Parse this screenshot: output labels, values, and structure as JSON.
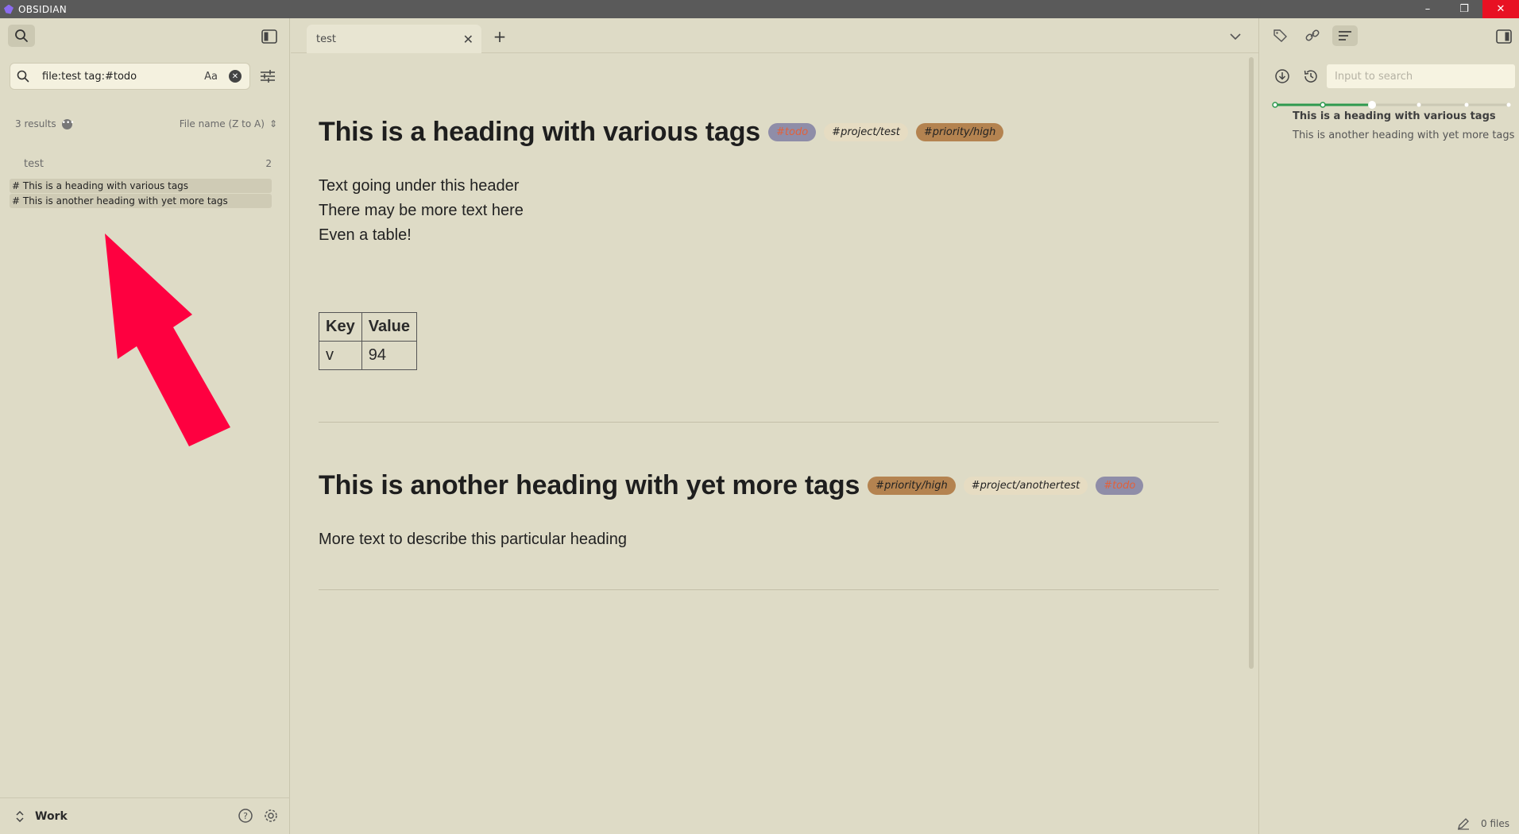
{
  "app": {
    "title": "OBSIDIAN"
  },
  "window": {
    "minimize": "–",
    "maximize": "❐",
    "close": "✕"
  },
  "left": {
    "search_query": "file:test tag:#todo",
    "match_case": "Aa",
    "results_count": "3 results",
    "sort_label": "File name (Z to A)",
    "result_file": "test",
    "result_file_count": "2",
    "matches": [
      "# This is a heading with various tags",
      "# This is another heading with yet more tags"
    ],
    "vault_name": "Work"
  },
  "tabs": [
    {
      "label": "test"
    }
  ],
  "doc": {
    "heading1": "This is a heading with various tags",
    "heading1_tags": [
      "#todo",
      "#project/test",
      "#priority/high"
    ],
    "para1_line1": "Text going under this header",
    "para1_line2": "There may be more text here",
    "para2": "Even a table!",
    "table": {
      "headers": [
        "Key",
        "Value"
      ],
      "rows": [
        [
          "v",
          "94"
        ]
      ]
    },
    "heading2": "This is another heading with yet more tags",
    "heading2_tags": [
      "#priority/high",
      "#project/anothertest",
      "#todo"
    ],
    "para3": "More text to describe this particular heading"
  },
  "right": {
    "search_placeholder": "Input to search",
    "outline": [
      "This is a heading with various tags",
      "This is another heading with yet more tags"
    ],
    "status_files": "0 files"
  },
  "colors": {
    "background": "#dedbc6",
    "tag_todo_bg": "#8f8da8",
    "tag_todo_text": "#e2613b",
    "tag_project_bg": "#e6dcc2",
    "tag_priority_bg": "#b48350",
    "annotation_arrow": "#fe0040",
    "slider_accent": "#2e9a4f"
  }
}
